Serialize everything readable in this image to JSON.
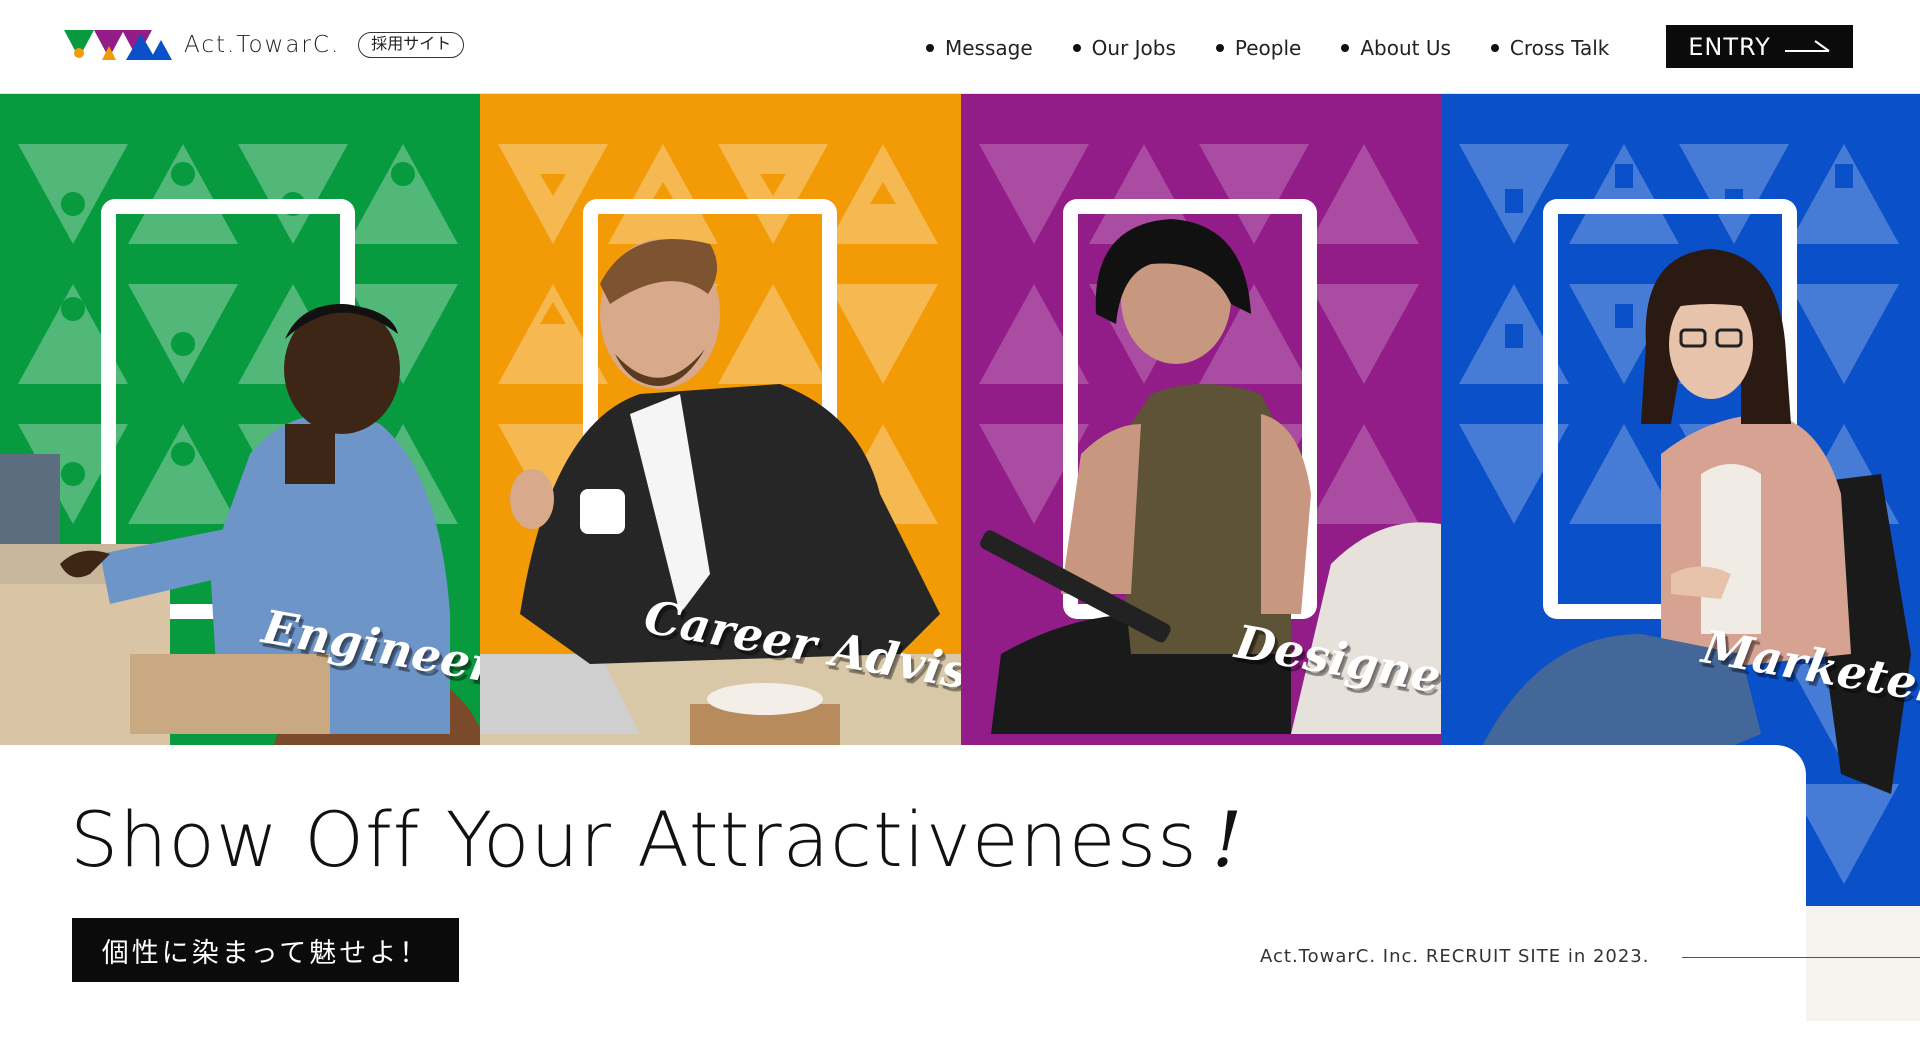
{
  "header": {
    "logo_text": "Act.TowarC.",
    "site_badge": "採用サイト",
    "nav": [
      {
        "label": "Message"
      },
      {
        "label": "Our Jobs"
      },
      {
        "label": "People"
      },
      {
        "label": "About Us"
      },
      {
        "label": "Cross Talk"
      }
    ],
    "entry_label": "ENTRY"
  },
  "hero": {
    "panels": [
      {
        "role": "Engineer",
        "color": "#079a3f"
      },
      {
        "role": "Career Adviser",
        "color": "#f39a07"
      },
      {
        "role": "Designer",
        "color": "#921c88"
      },
      {
        "role": "Marketer",
        "color": "#0a50c8"
      }
    ]
  },
  "main": {
    "headline": "Show Off Your Attractiveness",
    "headline_mark": "!",
    "jp_tagline": "個性に染まって魅せよ！",
    "copyright": "Act.TowarC. Inc. RECRUIT SITE in 2023."
  },
  "colors": {
    "green": "#079a3f",
    "orange": "#f39a07",
    "purple": "#921c88",
    "blue": "#0a50c8",
    "black": "#0b0b0b"
  }
}
